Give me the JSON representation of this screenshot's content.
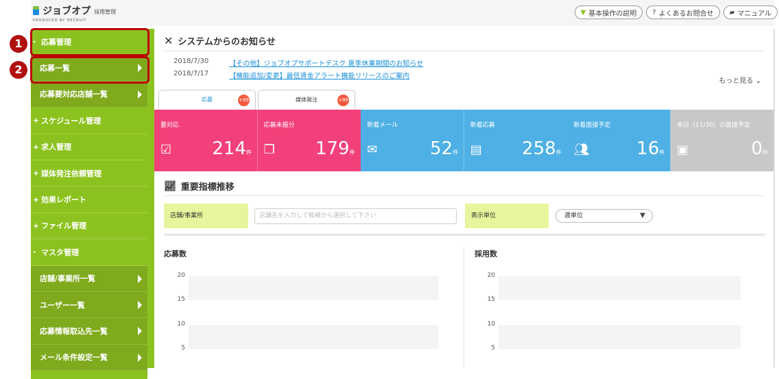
{
  "header": {
    "logo": "ジョブオプ",
    "logo_sub": "採用管理",
    "logo_by": "PRODUCED BY RECRUIT",
    "buttons": [
      {
        "label": "基本操作の説明",
        "icon": "beginner-icon"
      },
      {
        "label": "よくあるお問合せ",
        "icon": "question-icon"
      },
      {
        "label": "マニュアル",
        "icon": "book-icon"
      }
    ]
  },
  "sidebar": {
    "items": [
      {
        "label": "応募管理",
        "prefix": "-",
        "sub": false
      },
      {
        "label": "応募一覧",
        "sub": true
      },
      {
        "label": "応募要対応店舗一覧",
        "sub": true
      },
      {
        "label": "スケジュール管理",
        "prefix": "+",
        "sub": false
      },
      {
        "label": "求人管理",
        "prefix": "+",
        "sub": false
      },
      {
        "label": "媒体発注依頼管理",
        "prefix": "+",
        "sub": false
      },
      {
        "label": "効果レポート",
        "prefix": "+",
        "sub": false
      },
      {
        "label": "ファイル管理",
        "prefix": "+",
        "sub": false
      },
      {
        "label": "マスタ管理",
        "prefix": "-",
        "sub": false
      },
      {
        "label": "店舗/事業所一覧",
        "sub": true
      },
      {
        "label": "ユーザー一覧",
        "sub": true
      },
      {
        "label": "応募情報取込先一覧",
        "sub": true
      },
      {
        "label": "メール条件設定一覧",
        "sub": true
      }
    ]
  },
  "annotations": [
    "1",
    "2"
  ],
  "notice": {
    "title": "システムからのお知らせ",
    "items": [
      {
        "date": "2018/7/30",
        "text": "【その他】ジョブオプサポートデスク 夏季休業期間のお知らせ"
      },
      {
        "date": "2018/7/17",
        "text": "【機能追加/変更】最低賃金アラート機能リリースのご案内"
      }
    ],
    "more": "もっと見る"
  },
  "tabs": [
    {
      "label": "応募",
      "count": "+99"
    },
    {
      "label": "媒体発注",
      "count": "+99"
    }
  ],
  "cards": [
    {
      "label": "要対応",
      "value": "214",
      "unit": "件",
      "color": "#f2417a"
    },
    {
      "label": "応募未振分",
      "value": "179",
      "unit": "件",
      "color": "#f2417a"
    },
    {
      "label": "新着メール",
      "value": "52",
      "unit": "件",
      "color": "#4eb0e5"
    },
    {
      "label": "新着応募",
      "value": "258",
      "unit": "件",
      "color": "#4eb0e5"
    },
    {
      "label": "新着面接予定",
      "value": "16",
      "unit": "件",
      "color": "#4eb0e5"
    },
    {
      "label": "本日（11/30）の面接予定",
      "value": "0",
      "unit": "件",
      "color": "#c8c8c8"
    }
  ],
  "kpi": {
    "title": "重要指標推移",
    "store_label": "店舗/事業所",
    "store_placeholder": "店舗名を入力して候補から選択して下さい",
    "unit_label": "表示単位",
    "unit_value": "週単位"
  },
  "chart_data": [
    {
      "type": "line",
      "title": "応募数",
      "yticks": [
        "20",
        "15",
        "10",
        "5"
      ],
      "ylim": [
        5,
        20
      ],
      "series": []
    },
    {
      "type": "line",
      "title": "採用数",
      "yticks": [
        "20",
        "15",
        "10",
        "5"
      ],
      "ylim": [
        5,
        20
      ],
      "series": []
    }
  ]
}
